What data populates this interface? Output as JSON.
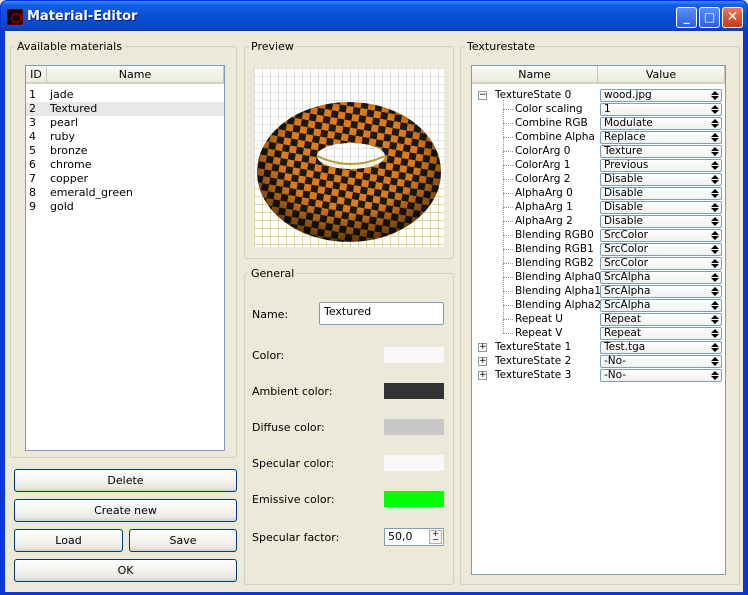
{
  "window": {
    "title": "Material-Editor"
  },
  "materials": {
    "group_label": "Available materials",
    "columns": [
      "ID",
      "Name"
    ],
    "rows": [
      {
        "id": "1",
        "name": "jade"
      },
      {
        "id": "2",
        "name": "Textured"
      },
      {
        "id": "3",
        "name": "pearl"
      },
      {
        "id": "4",
        "name": "ruby"
      },
      {
        "id": "5",
        "name": "bronze"
      },
      {
        "id": "6",
        "name": "chrome"
      },
      {
        "id": "7",
        "name": "copper"
      },
      {
        "id": "8",
        "name": "emerald_green"
      },
      {
        "id": "9",
        "name": "gold"
      }
    ],
    "selected_index": 1,
    "buttons": {
      "delete": "Delete",
      "create_new": "Create new",
      "load": "Load",
      "save": "Save",
      "ok": "OK"
    }
  },
  "preview": {
    "group_label": "Preview",
    "icon": "torus-checkerboard-render"
  },
  "general": {
    "group_label": "General",
    "name_label": "Name:",
    "name_value": "Textured",
    "color_label": "Color:",
    "ambient_label": "Ambient color:",
    "diffuse_label": "Diffuse color:",
    "specular_label": "Specular color:",
    "emissive_label": "Emissive color:",
    "specular_factor_label": "Specular factor:",
    "specular_factor_value": "50,0",
    "colors": {
      "color": "#f8f8f8",
      "ambient": "#333333",
      "diffuse": "#c8c8c8",
      "specular": "#f8f8f8",
      "emissive": "#00ff00"
    }
  },
  "texturestate": {
    "group_label": "Texturestate",
    "columns": [
      "Name",
      "Value"
    ],
    "state0": {
      "name": "TextureState 0",
      "value": "wood.jpg"
    },
    "props": [
      {
        "name": "Color scaling",
        "value": "1"
      },
      {
        "name": "Combine RGB",
        "value": "Modulate"
      },
      {
        "name": "Combine Alpha",
        "value": "Replace"
      },
      {
        "name": "ColorArg 0",
        "value": "Texture"
      },
      {
        "name": "ColorArg 1",
        "value": "Previous"
      },
      {
        "name": "ColorArg 2",
        "value": "Disable"
      },
      {
        "name": "AlphaArg 0",
        "value": "Disable"
      },
      {
        "name": "AlphaArg 1",
        "value": "Disable"
      },
      {
        "name": "AlphaArg 2",
        "value": "Disable"
      },
      {
        "name": "Blending RGB0",
        "value": "SrcColor"
      },
      {
        "name": "Blending RGB1",
        "value": "SrcColor"
      },
      {
        "name": "Blending RGB2",
        "value": "SrcColor"
      },
      {
        "name": "Blending Alpha0",
        "value": "SrcAlpha"
      },
      {
        "name": "Blending Alpha1",
        "value": "SrcAlpha"
      },
      {
        "name": "Blending Alpha2",
        "value": "SrcAlpha"
      },
      {
        "name": "Repeat U",
        "value": "Repeat"
      },
      {
        "name": "Repeat V",
        "value": "Repeat"
      }
    ],
    "others": [
      {
        "name": "TextureState 1",
        "value": "Test.tga"
      },
      {
        "name": "TextureState 2",
        "value": "-No-"
      },
      {
        "name": "TextureState 3",
        "value": "-No-"
      }
    ]
  }
}
